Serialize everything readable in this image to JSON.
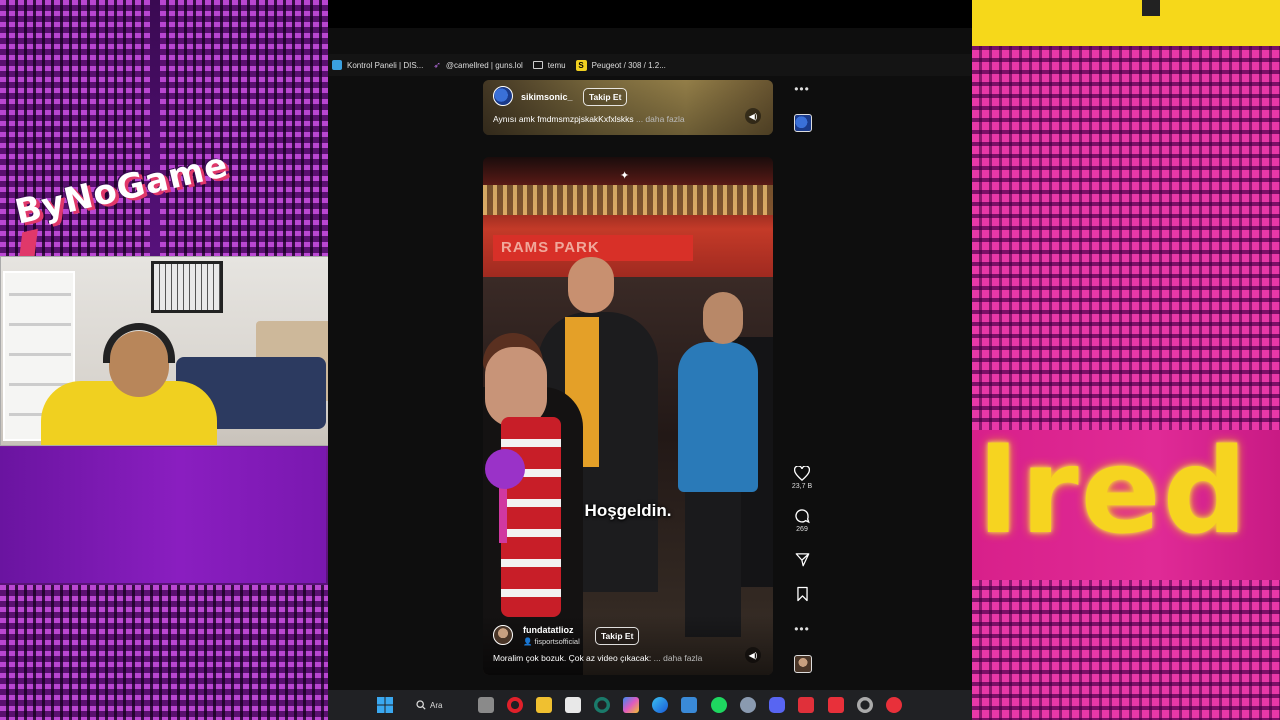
{
  "overlay": {
    "logo_text": "ByNoGame",
    "right_neon_text": "lred"
  },
  "bookmarks": [
    {
      "label": "Kontrol Paneli | DIS...",
      "icon": "dashboard-icon",
      "color": "#3aa0e0"
    },
    {
      "label": "@camellred | guns.lol",
      "icon": "rocket-icon",
      "color": "#b06ad8"
    },
    {
      "label": "temu",
      "icon": "folder-icon",
      "color": "#cccccc"
    },
    {
      "label": "Peugeot / 308 / 1.2...",
      "icon": "s-logo-icon",
      "color": "#f0d020"
    }
  ],
  "reel_top": {
    "username": "sikimsonic_",
    "follow_label": "Takip Et",
    "caption": "Aynısı amk fmdmsmzpjskakKxfxlskks",
    "more_label": "... daha fazla"
  },
  "reel_main": {
    "username": "fundatatlioz",
    "sub_user": "fisportsofficial",
    "follow_label": "Takip Et",
    "subtitle": "Hoşgeldin.",
    "caption": "Moralim çok bozuk. Çok az video çıkacak:",
    "more_label": "... daha fazla",
    "sign_text": "RAMS PARK"
  },
  "actions": {
    "likes": "23,7 B",
    "comments": "269"
  },
  "taskbar": {
    "search_label": "Ara",
    "icons": [
      "windows-start-icon",
      "search-icon",
      "task-view-icon",
      "opera-icon",
      "file-explorer-icon",
      "store-icon",
      "chatgpt-icon",
      "copilot-icon",
      "edge-icon",
      "mail-icon",
      "spotify-icon",
      "steam-icon",
      "discord-icon",
      "vivaldi-icon",
      "app-icon",
      "obs-icon",
      "recording-icon"
    ]
  },
  "colors": {
    "neon_yellow": "#f6d420",
    "magenta": "#c81a90",
    "purple": "#6a14a0",
    "instagram_bg": "#0e0e0e"
  }
}
